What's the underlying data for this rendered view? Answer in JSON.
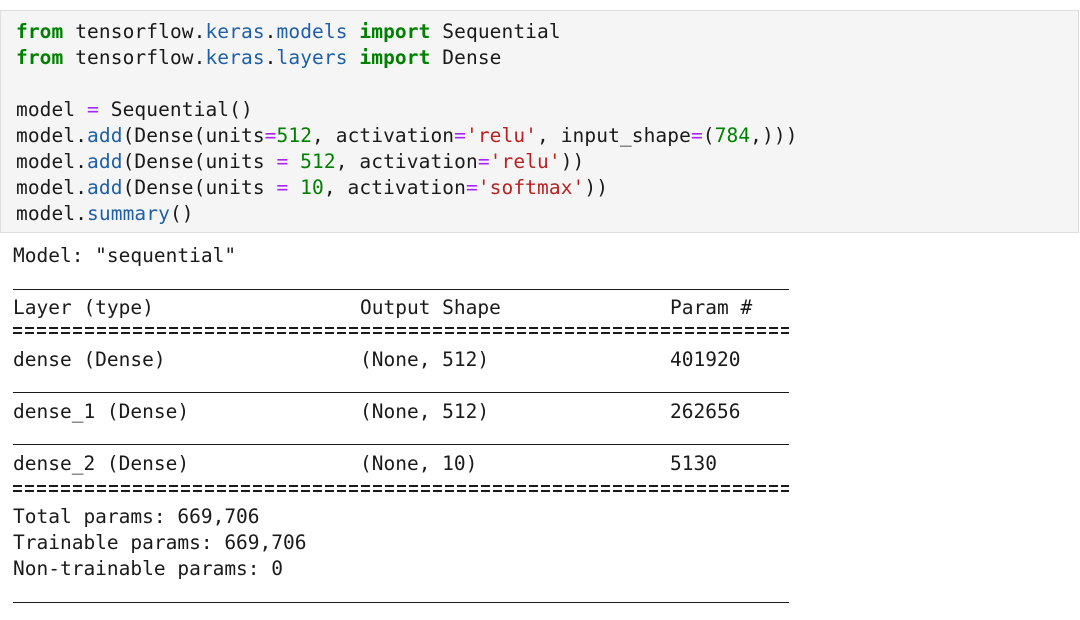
{
  "code": {
    "line1": {
      "kw1": "from",
      "mod1": "tensorflow",
      "dot1": ".",
      "mod2": "keras",
      "dot2": ".",
      "mod3": "models",
      "kw2": "import",
      "name": "Sequential"
    },
    "line2": {
      "kw1": "from",
      "mod1": "tensorflow",
      "dot1": ".",
      "mod2": "keras",
      "dot2": ".",
      "mod3": "layers",
      "kw2": "import",
      "name": "Dense"
    },
    "line3": {
      "lhs": "model",
      "op": "=",
      "rhs": "Sequential()"
    },
    "line4": {
      "p1": "model.",
      "fn": "add",
      "p2": "(Dense(units",
      "op1": "=",
      "n1": "512",
      "p3": ", activation",
      "op2": "=",
      "s1": "'relu'",
      "p4": ", input_shape",
      "op3": "=",
      "p5": "(",
      "n2": "784",
      "p6": ",)))"
    },
    "line5": {
      "p1": "model.",
      "fn": "add",
      "p2": "(Dense(units ",
      "op1": "=",
      "n1": " 512",
      "p3": ", activation",
      "op2": "=",
      "s1": "'relu'",
      "p4": "))"
    },
    "line6": {
      "p1": "model.",
      "fn": "add",
      "p2": "(Dense(units ",
      "op1": "=",
      "n1": " 10",
      "p3": ", activation",
      "op2": "=",
      "s1": "'softmax'",
      "p4": "))"
    },
    "line7": {
      "p1": "model.",
      "fn": "summary",
      "p2": "()"
    }
  },
  "output": {
    "model_title": "Model: \"sequential\"",
    "headers": {
      "layer": "Layer (type)",
      "shape": "Output Shape",
      "params": "Param #"
    },
    "rows": [
      {
        "layer": "dense (Dense)",
        "shape": "(None, 512)",
        "params": "401920"
      },
      {
        "layer": "dense_1 (Dense)",
        "shape": "(None, 512)",
        "params": "262656"
      },
      {
        "layer": "dense_2 (Dense)",
        "shape": "(None, 10)",
        "params": "5130"
      }
    ],
    "total_params": "Total params: 669,706",
    "trainable_params": "Trainable params: 669,706",
    "non_trainable_params": "Non-trainable params: 0"
  },
  "colors": {
    "keyword": "#008000",
    "module": "#1f5fa8",
    "operator": "#aa22ff",
    "number": "#008000",
    "string": "#ba2121",
    "cell_background": "#f5f5f5"
  }
}
